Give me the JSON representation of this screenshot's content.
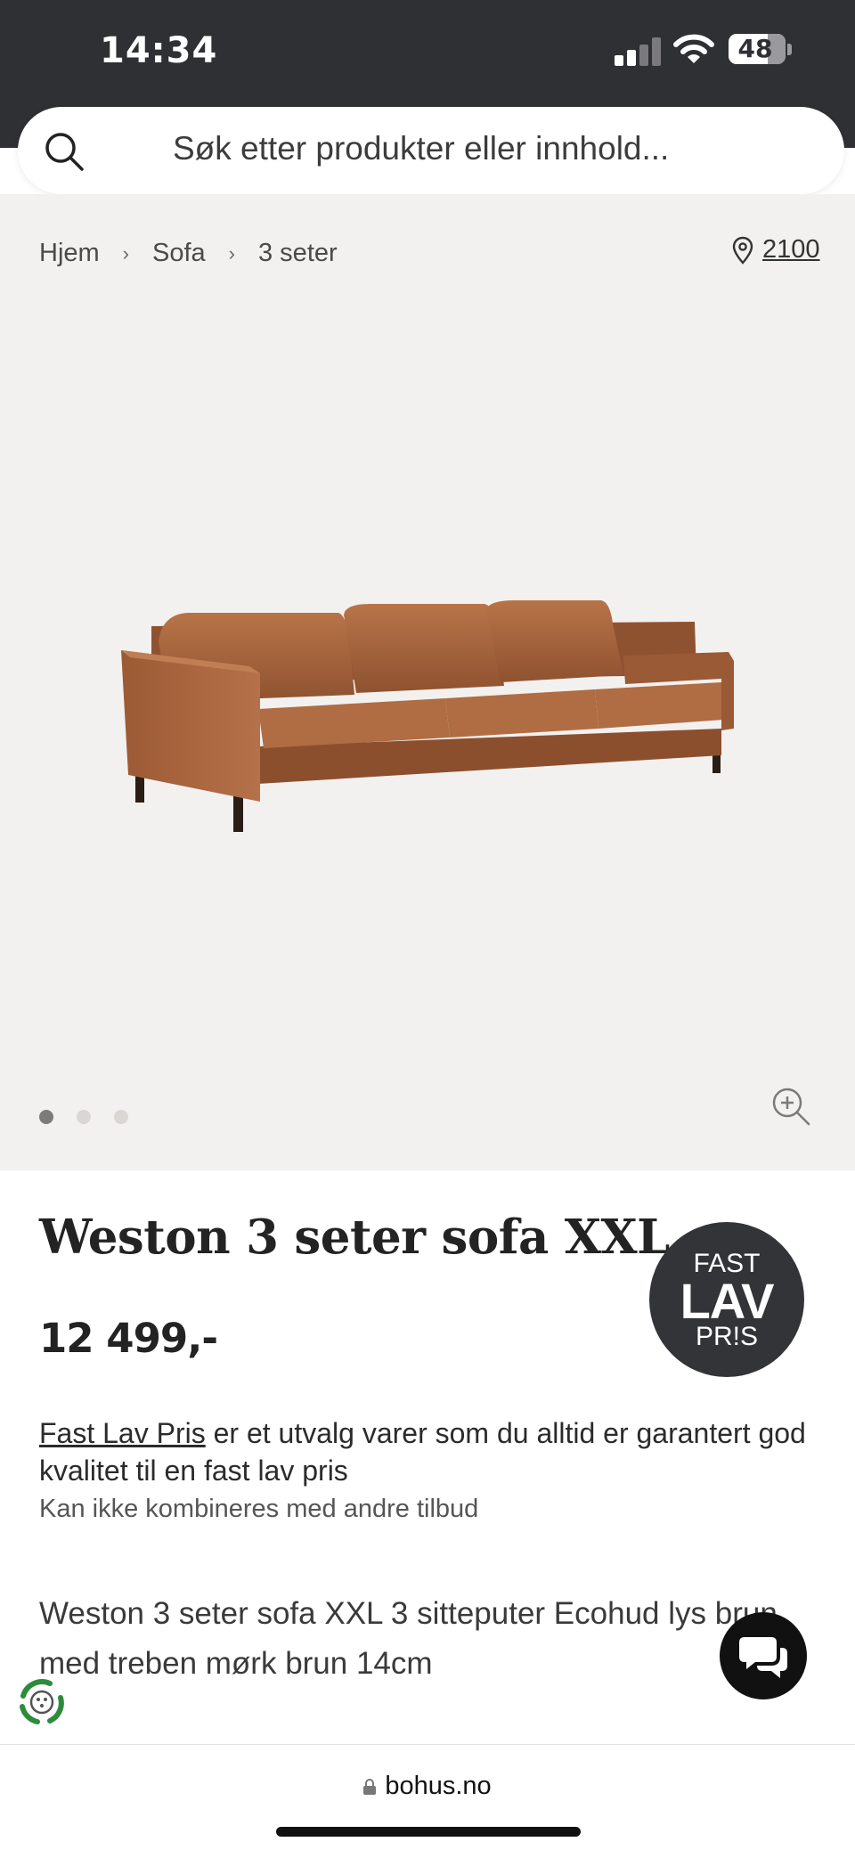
{
  "status_bar": {
    "time": "14:34",
    "battery": "48"
  },
  "search": {
    "placeholder": "Søk etter produkter eller innhold..."
  },
  "breadcrumb": {
    "items": [
      "Hjem",
      "Sofa",
      "3 seter"
    ]
  },
  "location": {
    "postal_code": "2100"
  },
  "gallery": {
    "image_count": 3,
    "active_index": 0
  },
  "product": {
    "title": "Weston 3 seter sofa XXL",
    "price": "12 499,-",
    "badge": {
      "line1": "FAST",
      "line2": "LAV",
      "line3": "PR!S"
    },
    "fast_lav_pris_link": "Fast Lav Pris",
    "fast_lav_pris_text": " er et utvalg varer som du alltid er garantert god kvalitet til en fast lav pris",
    "disclaimer": "Kan ikke kombineres med andre tilbud",
    "description": "Weston 3 seter sofa XXL 3 sitteputer Ecohud lys brun med treben mørk brun 14cm"
  },
  "browser": {
    "url": "bohus.no"
  },
  "colors": {
    "status_bar": "#2f3034",
    "gallery_bg": "#f3f1ef",
    "badge_bg": "#333437",
    "sofa_leather": "#a8663d"
  }
}
